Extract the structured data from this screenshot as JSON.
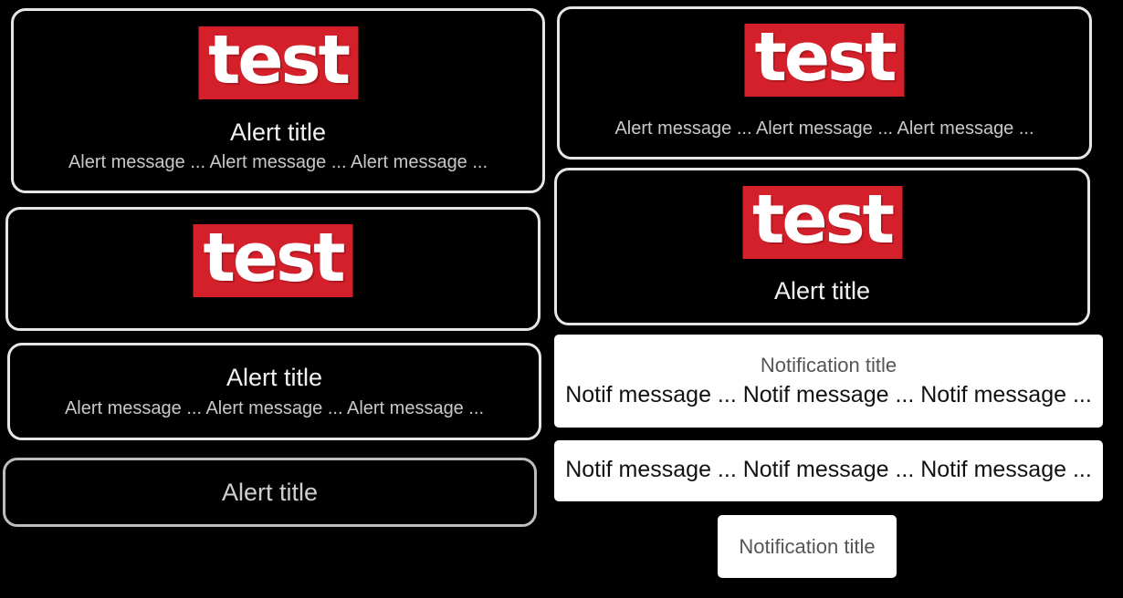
{
  "logo_text": "test",
  "alerts": [
    {
      "title": "Alert title",
      "message": "Alert message ... Alert message ... Alert message ..."
    },
    {
      "title": "Alert title",
      "message": "Alert message ... Alert message ... Alert message ..."
    },
    {
      "title": "Alert title"
    },
    {
      "message": "Alert message ... Alert message ... Alert message ..."
    },
    {
      "title": "Alert title"
    }
  ],
  "notifications": [
    {
      "title": "Notification title",
      "message": "Notif message ... Notif message ... Notif message ..."
    },
    {
      "message": "Notif message ... Notif message ... Notif message ..."
    },
    {
      "title": "Notification title"
    }
  ],
  "colors": {
    "background": "#000000",
    "alert_border": "#e6e6e6",
    "logo_red": "#d4202a",
    "notification_bg": "#ffffff"
  }
}
